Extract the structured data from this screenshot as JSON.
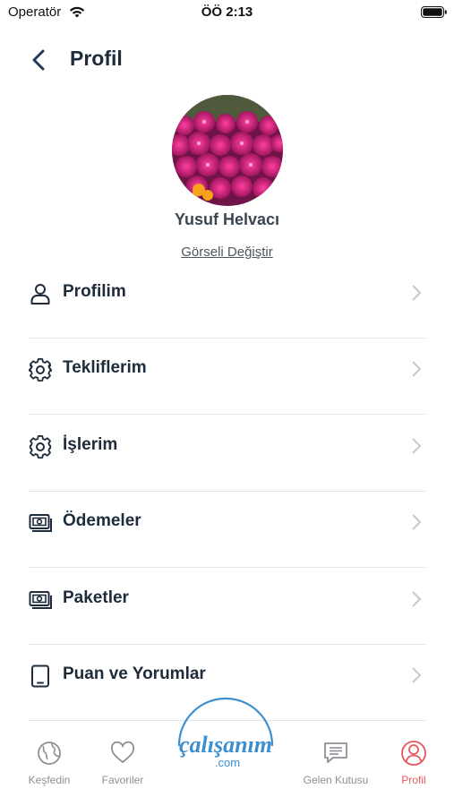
{
  "status_bar": {
    "carrier": "Operatör",
    "time": "ÖÖ 2:13"
  },
  "header": {
    "title": "Profil"
  },
  "profile": {
    "name": "Yusuf Helvacı",
    "change_photo": "Görseli Değiştir"
  },
  "menu": [
    {
      "label": "Profilim",
      "icon": "user-icon"
    },
    {
      "label": "Tekliflerim",
      "icon": "gear-icon"
    },
    {
      "label": "İşlerim",
      "icon": "gear-icon"
    },
    {
      "label": "Ödemeler",
      "icon": "money-icon"
    },
    {
      "label": "Paketler",
      "icon": "money-icon"
    },
    {
      "label": "Puan ve Yorumlar",
      "icon": "tablet-icon"
    }
  ],
  "tabs": [
    {
      "label": "Keşfedin",
      "icon": "globe-icon"
    },
    {
      "label": "Favoriler",
      "icon": "heart-icon"
    },
    {
      "label": "Gelen Kutusu",
      "icon": "message-icon"
    },
    {
      "label": "Profil",
      "icon": "profile-icon",
      "active": true
    }
  ],
  "logo": {
    "line1": "çalışanım",
    "line2": ".com"
  },
  "colors": {
    "accent": "#e8585e",
    "logo_blue": "#3b8fd0",
    "text": "#1e2b3a"
  }
}
